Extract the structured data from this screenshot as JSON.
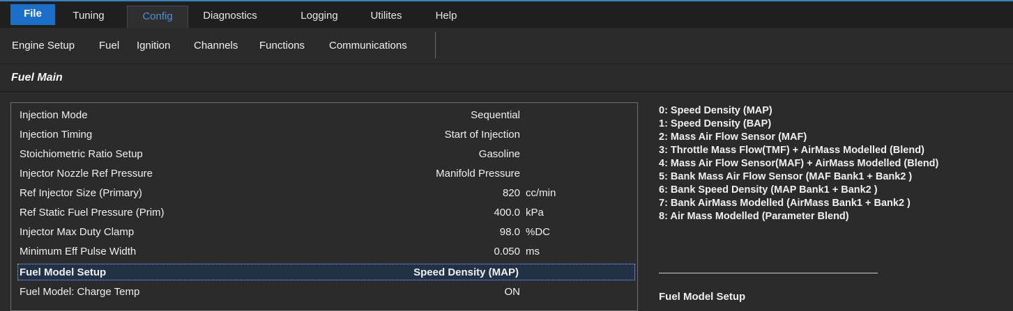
{
  "menu": {
    "items": [
      {
        "id": "file",
        "label": "File"
      },
      {
        "id": "tuning",
        "label": "Tuning"
      },
      {
        "id": "config",
        "label": "Config"
      },
      {
        "id": "diagnostics",
        "label": "Diagnostics"
      },
      {
        "id": "logging",
        "label": "Logging"
      },
      {
        "id": "utilites",
        "label": "Utilites"
      },
      {
        "id": "help",
        "label": "Help"
      }
    ]
  },
  "submenu": {
    "items": [
      {
        "label": "Engine Setup"
      },
      {
        "label": "Fuel"
      },
      {
        "label": "Ignition"
      },
      {
        "label": "Channels"
      },
      {
        "label": "Functions"
      },
      {
        "label": "Communications"
      }
    ]
  },
  "section": {
    "title": "Fuel Main"
  },
  "params": [
    {
      "label": "Injection Mode",
      "value": "Sequential",
      "unit": ""
    },
    {
      "label": "Injection Timing",
      "value": "Start of Injection",
      "unit": ""
    },
    {
      "label": "Stoichiometric Ratio Setup",
      "value": "Gasoline",
      "unit": ""
    },
    {
      "label": "Injector Nozzle Ref Pressure",
      "value": "Manifold Pressure",
      "unit": ""
    },
    {
      "label": "Ref Injector Size (Primary)",
      "value": "820",
      "unit": "cc/min"
    },
    {
      "label": "Ref Static Fuel Pressure (Prim)",
      "value": "400.0",
      "unit": "kPa"
    },
    {
      "label": "Injector Max Duty Clamp",
      "value": "98.0",
      "unit": "%DC"
    },
    {
      "label": "Minimum Eff Pulse Width",
      "value": "0.050",
      "unit": "ms"
    },
    {
      "label": "Fuel Model Setup",
      "value": "Speed Density (MAP)",
      "unit": ""
    },
    {
      "label": "Fuel Model: Charge Temp",
      "value": "ON",
      "unit": ""
    }
  ],
  "help": {
    "options": [
      "0: Speed Density (MAP)",
      "1: Speed Density (BAP)",
      "2: Mass Air Flow Sensor (MAF)",
      "3: Throttle Mass Flow(TMF) + AirMass Modelled  (Blend)",
      "4: Mass Air Flow Sensor(MAF) + AirMass Modelled (Blend)",
      "5: Bank Mass Air Flow Sensor (MAF Bank1 + Bank2 )",
      "6: Bank Speed Density (MAP Bank1 + Bank2 )",
      "7: Bank AirMass Modelled (AirMass Bank1 + Bank2 )",
      "8: Air Mass Modelled (Parameter Blend)"
    ],
    "heading": "Fuel Model Setup"
  }
}
